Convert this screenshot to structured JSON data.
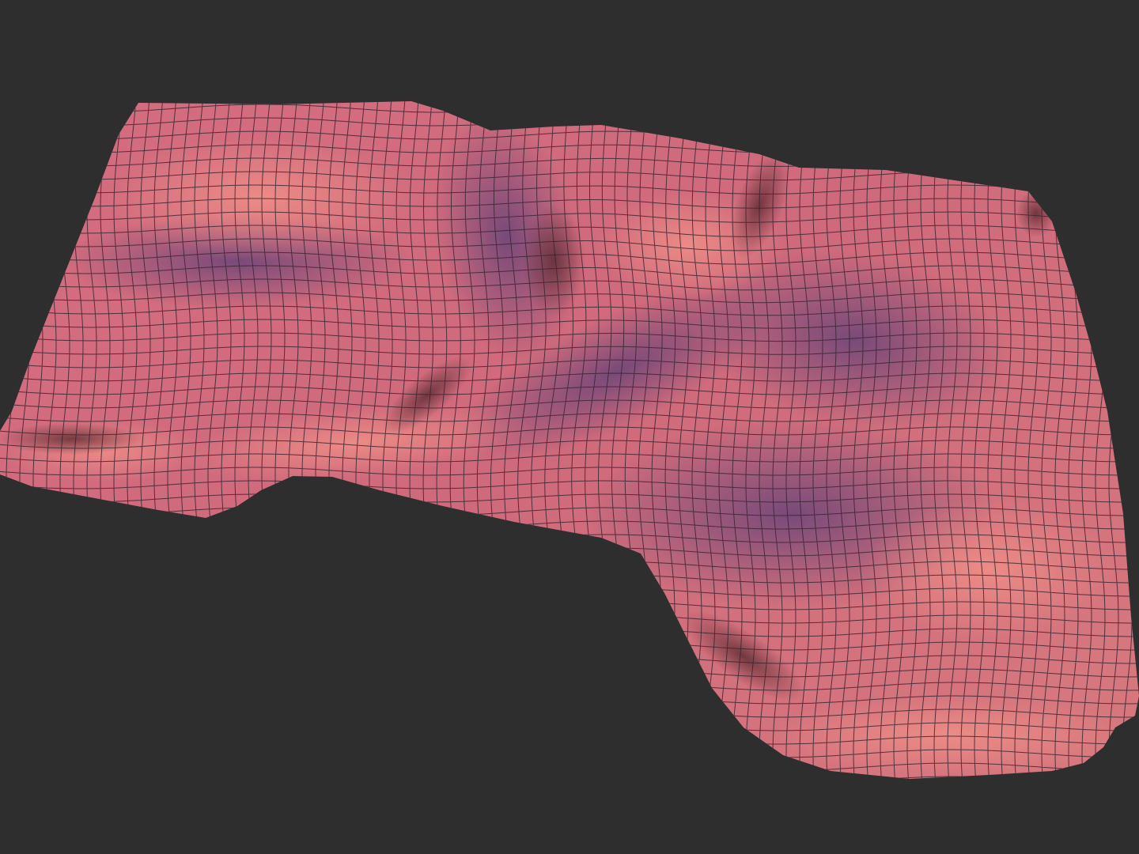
{
  "scene": {
    "background_color": "#2e2e2e",
    "surface_color": "#d9707a",
    "surface_highlight_color": "#e98a86",
    "surface_shadow_color": "#7a4a78",
    "wire_color": "#3a2430",
    "object": "terrain-mesh",
    "shading": "smooth",
    "wireframe": true
  }
}
